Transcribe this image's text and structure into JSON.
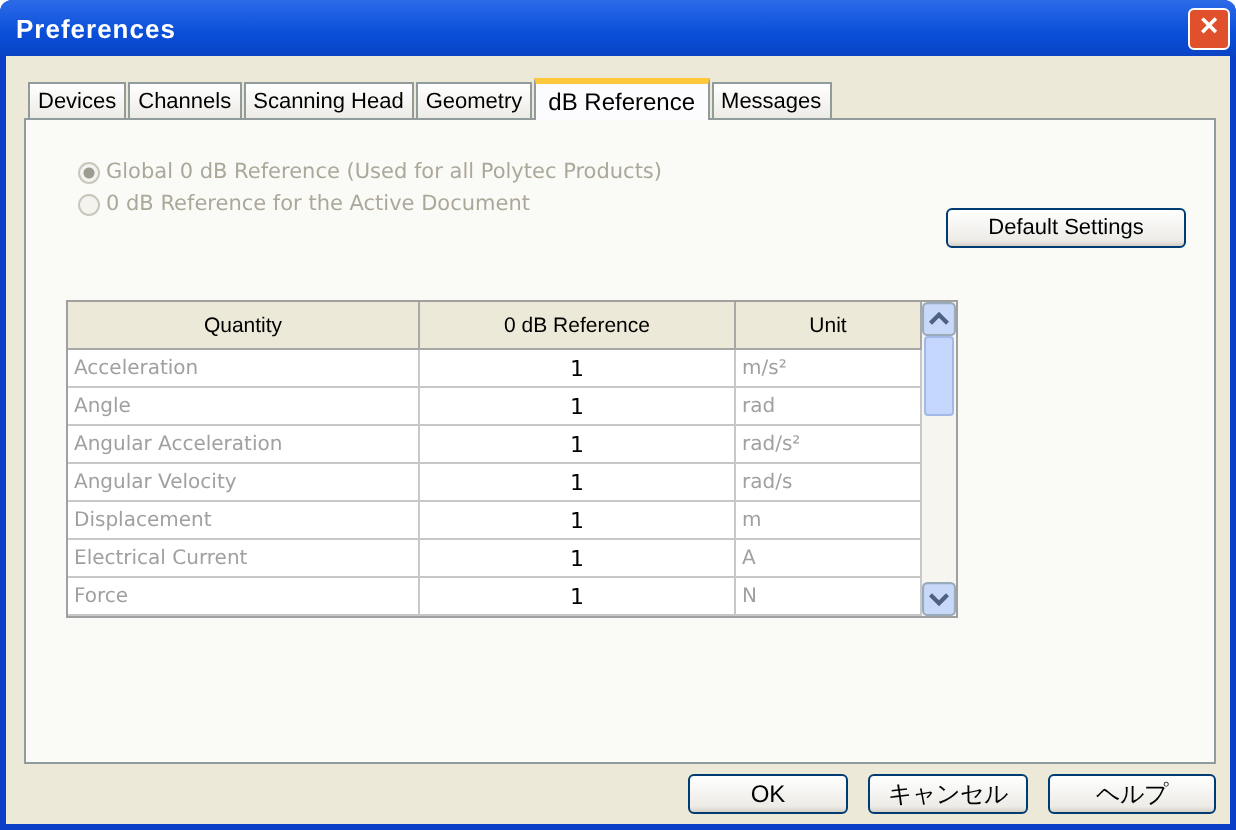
{
  "window": {
    "title": "Preferences",
    "close": "×"
  },
  "tabs": [
    {
      "label": "Devices",
      "selected": false
    },
    {
      "label": "Channels",
      "selected": false
    },
    {
      "label": "Scanning Head",
      "selected": false
    },
    {
      "label": "Geometry",
      "selected": false
    },
    {
      "label": "dB Reference",
      "selected": true
    },
    {
      "label": "Messages",
      "selected": false
    }
  ],
  "radios": [
    {
      "label": "Global 0 dB Reference (Used for all Polytec Products)",
      "selected": true,
      "disabled": true
    },
    {
      "label": "0 dB Reference for the Active Document",
      "selected": false,
      "disabled": true
    }
  ],
  "default_button": "Default Settings",
  "table": {
    "columns": [
      "Quantity",
      "0 dB Reference",
      "Unit"
    ],
    "rows": [
      {
        "quantity": "Acceleration",
        "reference": "1",
        "unit": "m/s²"
      },
      {
        "quantity": "Angle",
        "reference": "1",
        "unit": "rad"
      },
      {
        "quantity": "Angular Acceleration",
        "reference": "1",
        "unit": "rad/s²"
      },
      {
        "quantity": "Angular Velocity",
        "reference": "1",
        "unit": "rad/s"
      },
      {
        "quantity": "Displacement",
        "reference": "1",
        "unit": "m"
      },
      {
        "quantity": "Electrical Current",
        "reference": "1",
        "unit": "A"
      },
      {
        "quantity": "Force",
        "reference": "1",
        "unit": "N"
      }
    ]
  },
  "buttons": [
    "OK",
    "キャンセル",
    "ヘルプ"
  ]
}
